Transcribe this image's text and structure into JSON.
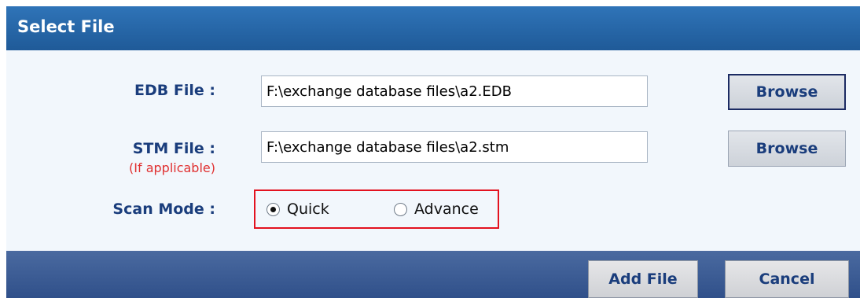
{
  "dialog": {
    "title": "Select File"
  },
  "edb": {
    "label": "EDB File :",
    "value": "F:\\exchange database files\\a2.EDB",
    "browse_label": "Browse"
  },
  "stm": {
    "label": "STM File :",
    "note": "(If applicable)",
    "value": "F:\\exchange database files\\a2.stm",
    "browse_label": "Browse"
  },
  "scan_mode": {
    "label": "Scan Mode :",
    "options": [
      {
        "label": "Quick",
        "selected": true
      },
      {
        "label": "Advance",
        "selected": false
      }
    ]
  },
  "footer": {
    "add_label": "Add File",
    "cancel_label": "Cancel"
  },
  "colors": {
    "title_bar": "#2f74b8",
    "label_text": "#1a3d7c",
    "note_text": "#e03030",
    "highlight_box": "#e3121f",
    "footer_bar": "#3a5a92"
  }
}
